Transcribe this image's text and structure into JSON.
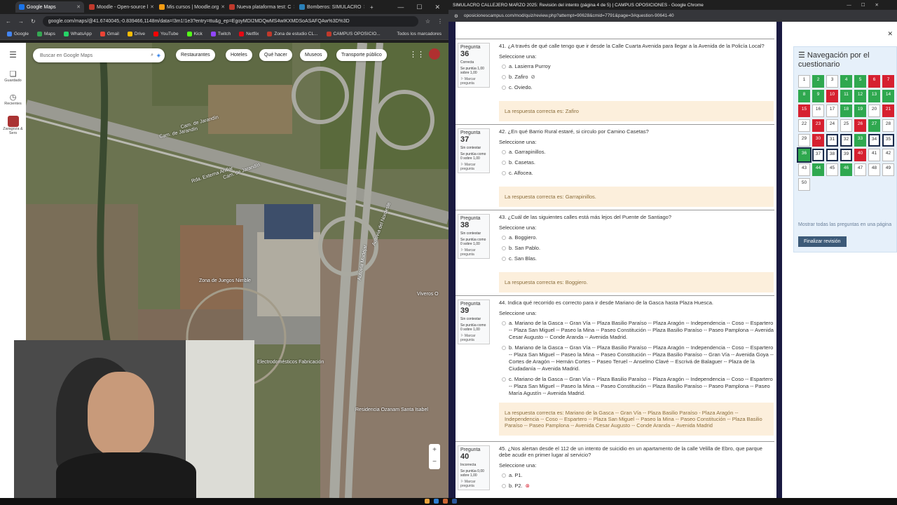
{
  "left_browser": {
    "tabs": [
      {
        "label": "Google Maps",
        "color": "#1a73e8",
        "active": true
      },
      {
        "label": "Moodle - Open-source l",
        "color": "#c0392b"
      },
      {
        "label": "Mis cursos | Moodle.org",
        "color": "#f39c12"
      },
      {
        "label": "Nueva plataforma test: C",
        "color": "#c0392b"
      },
      {
        "label": "Bomberos: SIMULACRO",
        "color": "#2980b9"
      }
    ],
    "url": "google.com/maps/@41.6740045,-0.839466,1148m/data=!3m1!1e3?entry=ttu&g_ep=EgoyMDI2MDQwMS4wIKXMDSoASAFQAw%3D%3D",
    "bookmarks": [
      "Google",
      "Maps",
      "WhatsApp",
      "Gmail",
      "Drive",
      "YouTube",
      "Kick",
      "Twitch",
      "Netflix",
      "Zona de estudio CL...",
      "CAMPUS OPOSICIO..."
    ],
    "bookmarks_right": "Todos los marcadores"
  },
  "maps": {
    "search_placeholder": "Buscar en Google Maps",
    "chips": [
      "Restaurantes",
      "Hoteles",
      "Qué hacer",
      "Museos",
      "Transporte público"
    ],
    "sidebar": [
      "Guardado",
      "Recientes",
      "Zaragoza & Sers"
    ],
    "labels": [
      "Cam. de Jarandín",
      "Rda. Externa Anillar",
      "Autovía del Nordeste",
      "Autovía Mudéjar",
      "Cam. de Jarandín",
      "Zona de Juegos Nimble",
      "Electrodomésticos Fabricación",
      "Residencia Ozanam Santa Isabel",
      "Viveros O",
      "Cam. de Jarandín"
    ]
  },
  "moodle": {
    "window_title": "SIMULACRO CALLEJERO MARZO 2025: Revisión del intento (página 4 de 5) | CAMPUS OPOSICIONES - Google Chrome",
    "url": "oposicionescampus.com/mod/quiz/review.php?attempt=90628&cmid=7791&page=3#question-90641-40",
    "questions": [
      {
        "label": "Pregunta",
        "num": "36",
        "status": "Correcta",
        "score": "Se puntúa 1,00 sobre 1,00",
        "flag": "Marcar pregunta",
        "text": "41. ¿A través de qué calle tengo que ir desde la Calle Cuarta Avenida para llegar a la Avenida de la Policía Local?",
        "select": "Seleccione una:",
        "options": [
          "a.  Lasierra Purroy",
          "b.  Zafiro",
          "c.  Oviedo."
        ],
        "answer": "La respuesta correcta es: Zafiro"
      },
      {
        "label": "Pregunta",
        "num": "37",
        "status": "Sin contestar",
        "score": "Se puntúa como 0 sobre 1,00",
        "flag": "Marcar pregunta",
        "text": "42. ¿En qué Barrio Rural estaré, si circulo por Camino Casetas?",
        "select": "Seleccione una:",
        "options": [
          "a.  Garrapinillos.",
          "b.  Casetas.",
          "c.  Alfocea."
        ],
        "answer": "La respuesta correcta es: Garrapinillos."
      },
      {
        "label": "Pregunta",
        "num": "38",
        "status": "Sin contestar",
        "score": "Se puntúa como 0 sobre 1,00",
        "flag": "Marcar pregunta",
        "text": "43. ¿Cuál de las siguientes calles está más lejos del Puente de Santiago?",
        "select": "Seleccione una:",
        "options": [
          "a.  Boggiero.",
          "b.  San Pablo.",
          "c.  San Blas."
        ],
        "answer": "La respuesta correcta es: Boggiero."
      },
      {
        "label": "Pregunta",
        "num": "39",
        "status": "Sin contestar",
        "score": "Se puntúa como 0 sobre 1,00",
        "flag": "Marcar pregunta",
        "text": "44. Indica qué recorrido es correcto para ir desde Mariano de la Gasca hasta Plaza Huesca.",
        "select": "Seleccione una:",
        "options": [
          "a.  Mariano de la Gasca -- Gran Vía -- Plaza Basilio Paraíso -- Plaza Aragón -- Independencia -- Coso -- Espartero -- Plaza San Miguel -- Paseo la Mina -- Paseo Constitución -- Plaza Basilio Paraíso -- Paseo Pamplona -- Avenida Cesar Augusto -- Conde Aranda -- Avenida Madrid.",
          "b.  Mariano de la Gasca -- Gran Vía -- Plaza Basilio Paraíso -- Plaza Aragón -- Independencia -- Coso -- Espartero -- Plaza San Miguel -- Paseo la Mina -- Paseo Constitución -- Plaza Basilio Paraíso -- Gran Vía -- Avenida Goya -- Cortes de Aragón -- Hernán Cortes -- Paseo Teruel -- Anselmo Clavé -- Escrivá de Balaguer -- Plaza de la Ciudadanía -- Avenida Madrid.",
          "c.  Mariano de la Gasca -- Gran Vía -- Plaza Basilio Paraíso -- Plaza Aragón -- Independencia -- Coso -- Espartero -- Plaza San Miguel -- Paseo la Mina -- Paseo Constitución -- Plaza Basilio Paraíso -- Paseo Pamplona -- Paseo María Agustín -- Avenida Madrid."
        ],
        "answer": "La respuesta correcta es: Mariano de la Gasca -- Gran Vía -- Plaza Basilio Paraíso - Plaza Aragón -- Independencia -- Coso -- Espartero -- Plaza San Miguel -- Paseo la Mina -- Paseo Constitución -- Plaza Basilio Paraíso -- Paseo Pamplona -- Avenida Cesar Augusto -- Conde Aranda -- Avenida Madrid"
      },
      {
        "label": "Pregunta",
        "num": "40",
        "status": "Incorrecta",
        "score": "Se puntúa 0,00 sobre 1,00",
        "flag": "Marcar pregunta",
        "text": "45. ¿Nos alertan desde el 112 de un intento de suicidio en un apartamento de la calle Velilla de Ebro, que parque debe acudir en primer lugar al servicio?",
        "select": "Seleccione una:",
        "options": [
          "a.  P1.",
          "b.  P2."
        ],
        "answer": ""
      }
    ],
    "nav": {
      "title": "Navegación por el cuestionario",
      "show_all": "Mostrar todas las preguntas en una página",
      "finish": "Finalizar revisión",
      "cells": [
        {
          "n": "1",
          "s": "w"
        },
        {
          "n": "2",
          "s": "g"
        },
        {
          "n": "3",
          "s": "w"
        },
        {
          "n": "4",
          "s": "g"
        },
        {
          "n": "5",
          "s": "g"
        },
        {
          "n": "6",
          "s": "r"
        },
        {
          "n": "7",
          "s": "r"
        },
        {
          "n": "8",
          "s": "g"
        },
        {
          "n": "9",
          "s": "g"
        },
        {
          "n": "10",
          "s": "r"
        },
        {
          "n": "11",
          "s": "g"
        },
        {
          "n": "12",
          "s": "g"
        },
        {
          "n": "13",
          "s": "g"
        },
        {
          "n": "14",
          "s": "g"
        },
        {
          "n": "15",
          "s": "r"
        },
        {
          "n": "16",
          "s": "w"
        },
        {
          "n": "17",
          "s": "w"
        },
        {
          "n": "18",
          "s": "g"
        },
        {
          "n": "19",
          "s": "g"
        },
        {
          "n": "20",
          "s": "w"
        },
        {
          "n": "21",
          "s": "r"
        },
        {
          "n": "22",
          "s": "w"
        },
        {
          "n": "23",
          "s": "r"
        },
        {
          "n": "24",
          "s": "w"
        },
        {
          "n": "25",
          "s": "w"
        },
        {
          "n": "26",
          "s": "r"
        },
        {
          "n": "27",
          "s": "g"
        },
        {
          "n": "28",
          "s": "w"
        },
        {
          "n": "29",
          "s": "w"
        },
        {
          "n": "30",
          "s": "r"
        },
        {
          "n": "31",
          "s": "d"
        },
        {
          "n": "32",
          "s": "d"
        },
        {
          "n": "33",
          "s": "g"
        },
        {
          "n": "34",
          "s": "d"
        },
        {
          "n": "35",
          "s": "d"
        },
        {
          "n": "36",
          "s": "g"
        },
        {
          "n": "37",
          "s": "d"
        },
        {
          "n": "38",
          "s": "d"
        },
        {
          "n": "39",
          "s": "d"
        },
        {
          "n": "40",
          "s": "r"
        },
        {
          "n": "41",
          "s": "w"
        },
        {
          "n": "42",
          "s": "w"
        },
        {
          "n": "43",
          "s": "w"
        },
        {
          "n": "44",
          "s": "g"
        },
        {
          "n": "45",
          "s": "w"
        },
        {
          "n": "46",
          "s": "g"
        },
        {
          "n": "47",
          "s": "w"
        },
        {
          "n": "48",
          "s": "w"
        },
        {
          "n": "49",
          "s": "w"
        },
        {
          "n": "50",
          "s": "w"
        }
      ]
    }
  },
  "colors": {
    "correct": "#2fa84f",
    "wrong": "#d62030",
    "answer_bg": "#fcefdc",
    "nav_bg": "#e6f0fa",
    "moodle_dark": "#1a1a40"
  }
}
